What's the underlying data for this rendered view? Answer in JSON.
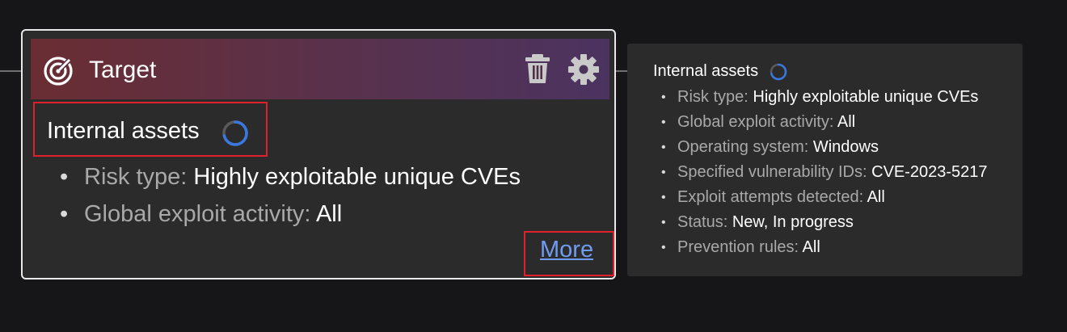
{
  "card": {
    "title": "Target",
    "icons": {
      "target": "target-icon",
      "delete": "trash-icon",
      "settings": "gear-icon"
    },
    "asset_name": "Internal assets",
    "filters": [
      {
        "label": "Risk type:",
        "value": "Highly exploitable unique CVEs"
      },
      {
        "label": "Global exploit activity:",
        "value": "All"
      }
    ],
    "more_link": "More"
  },
  "tooltip": {
    "title": "Internal assets",
    "filters": [
      {
        "label": "Risk type:",
        "value": "Highly exploitable unique CVEs"
      },
      {
        "label": "Global exploit activity:",
        "value": "All"
      },
      {
        "label": "Operating system:",
        "value": "Windows"
      },
      {
        "label": "Specified vulnerability IDs:",
        "value": "CVE-2023-5217"
      },
      {
        "label": "Exploit attempts detected:",
        "value": "All"
      },
      {
        "label": "Status:",
        "value": "New, In progress"
      },
      {
        "label": "Prevention rules:",
        "value": "All"
      }
    ]
  },
  "colors": {
    "background": "#161517",
    "card": "#2b2b2b",
    "header_gradient_start": "#6a2d33",
    "header_gradient_end": "#4b3360",
    "highlight": "#e0202b",
    "link": "#6f9cf0",
    "spinner": "#3a78e0"
  }
}
